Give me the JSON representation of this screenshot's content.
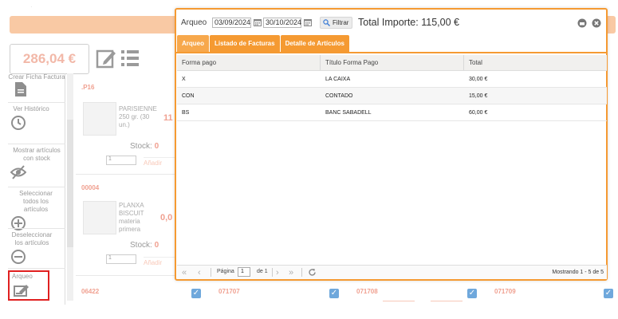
{
  "background": {
    "total_amount": "286,04 €",
    "sidebar": [
      {
        "label": "Crear Ficha Factura",
        "icon": "document-icon"
      },
      {
        "label": "Ver Histórico",
        "icon": "history-icon"
      },
      {
        "label": "Mostrar artículos con stock",
        "icon": "eye-slash-icon"
      },
      {
        "label": "Seleccionar todos los artículos",
        "icon": "plus-circle-icon"
      },
      {
        "label": "Deseleccionar los artículos",
        "icon": "minus-circle-icon"
      },
      {
        "label": "Arqueo",
        "icon": "arqueo-icon"
      }
    ],
    "products": [
      {
        "code": ".P16",
        "name": "PARISIENNE 250 gr. (30 un.)",
        "price": "11",
        "stock_label": "Stock:",
        "stock": "0",
        "qty": "1",
        "add": "Añadir"
      },
      {
        "code": "00004",
        "name": "PLANXA BISCUIT materia primera",
        "price": "0,0",
        "stock_label": "Stock:",
        "stock": "0",
        "qty": "1",
        "add": "Añadir"
      }
    ],
    "bottom_codes": [
      "06422",
      "071707",
      "071708",
      "071709"
    ]
  },
  "modal": {
    "title": "Arqueo",
    "date_from": "03/09/2024",
    "date_to": "30/10/2024",
    "filter_label": "Filtrar",
    "total_label": "Total Importe:",
    "total_value": "115,00 €",
    "tabs": [
      "Arqueo",
      "Listado de Facturas",
      "Detalle de Artículos"
    ],
    "columns": [
      "Forma pago",
      "Título Forma Pago",
      "Total"
    ],
    "rows": [
      {
        "code": "X",
        "title": "LA CAIXA",
        "total": "30,00 €"
      },
      {
        "code": "CON",
        "title": "CONTADO",
        "total": "15,00 €"
      },
      {
        "code": "BS",
        "title": "BANC SABADELL",
        "total": "60,00 €"
      }
    ],
    "pager": {
      "page_label": "Página",
      "page": "1",
      "of_label": "de 1",
      "showing": "Mostrando 1 - 5 de 5"
    }
  },
  "colors": {
    "accent": "#f59a32",
    "highlight": "#e02020",
    "check": "#6fa8dc"
  }
}
